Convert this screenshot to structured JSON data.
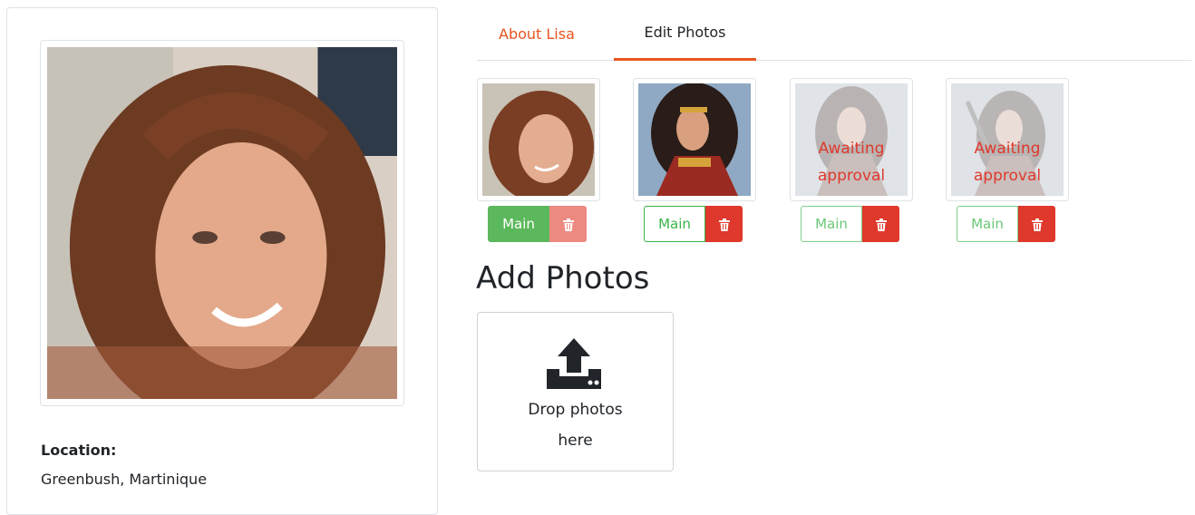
{
  "profile": {
    "location_label": "Location:",
    "location_value": "Greenbush, Martinique"
  },
  "tabs": [
    {
      "label": "About Lisa",
      "active": false
    },
    {
      "label": "Edit Photos",
      "active": true
    }
  ],
  "photos": [
    {
      "main_label": "Main",
      "status": "",
      "is_main": true
    },
    {
      "main_label": "Main",
      "status": "",
      "is_main": false
    },
    {
      "main_label": "Main",
      "status": "Awaiting approval",
      "is_main": false
    },
    {
      "main_label": "Main",
      "status": "Awaiting approval",
      "is_main": false
    }
  ],
  "add_photos": {
    "title": "Add Photos",
    "drop_text": "Drop photos here",
    "icon": "upload-icon"
  },
  "colors": {
    "accent": "#e95420",
    "success": "#38b44a",
    "danger": "#df382c"
  }
}
